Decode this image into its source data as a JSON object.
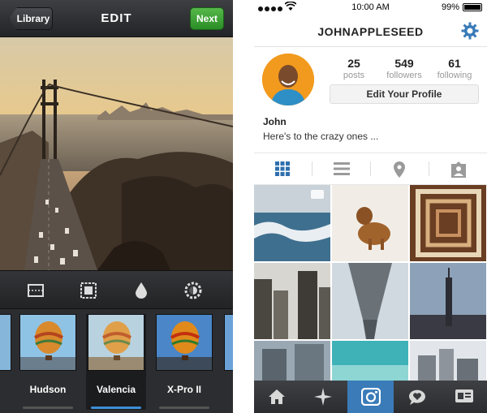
{
  "edit_screen": {
    "back_label": "Library",
    "title": "EDIT",
    "next_label": "Next",
    "tools": [
      "frame-icon",
      "border-icon",
      "tilt-shift-icon",
      "lux-icon"
    ],
    "filters": [
      {
        "label": "Hudson",
        "selected": false
      },
      {
        "label": "Valencia",
        "selected": true
      },
      {
        "label": "X-Pro II",
        "selected": false
      }
    ]
  },
  "status_bar": {
    "time": "10:00 AM",
    "battery": "99%"
  },
  "profile": {
    "username": "JOHNAPPLESEED",
    "stats": [
      {
        "value": "25",
        "label": "posts"
      },
      {
        "value": "549",
        "label": "followers"
      },
      {
        "value": "61",
        "label": "following"
      }
    ],
    "edit_button": "Edit Your Profile",
    "name": "John",
    "bio": "Here's to the crazy ones ...",
    "view_tabs": [
      "grid-icon",
      "list-icon",
      "map-pin-icon",
      "photos-of-you-icon"
    ],
    "tab_bar": [
      "home-icon",
      "explore-icon",
      "camera-icon",
      "activity-icon",
      "profile-icon"
    ],
    "active_tab": "camera-icon"
  },
  "colors": {
    "accent_blue": "#3a7bb8",
    "next_green": "#3fa33a",
    "avatar_orange": "#f29a1d"
  }
}
